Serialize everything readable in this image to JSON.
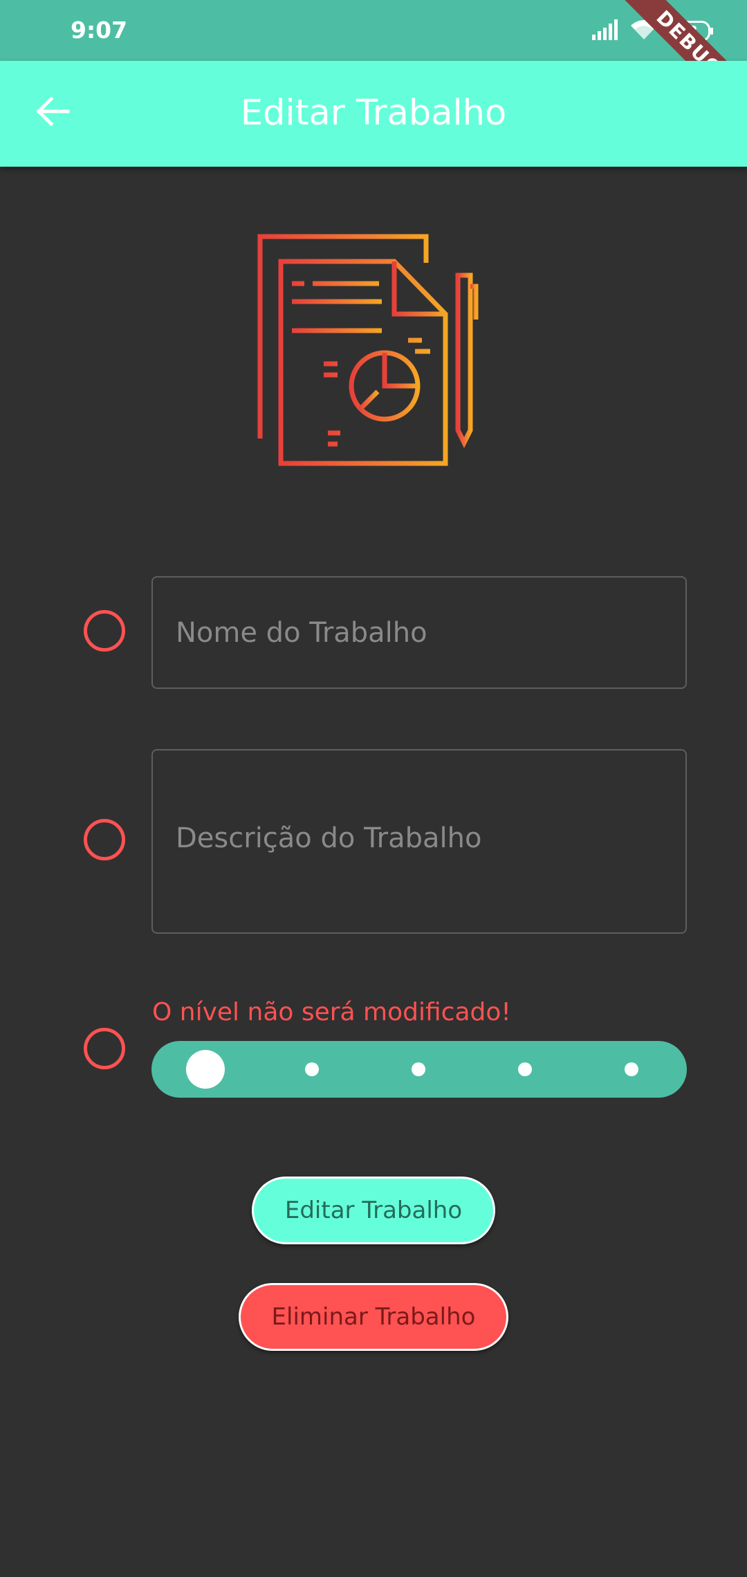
{
  "status_bar": {
    "time": "9:07",
    "battery": "92",
    "icons": [
      "signal-icon",
      "wifi-icon",
      "battery-icon"
    ]
  },
  "debug_banner": "DEBUG",
  "app_bar": {
    "title": "Editar Trabalho",
    "back_icon": "arrow-back-icon"
  },
  "colors": {
    "status_bar": "#4dbea3",
    "app_bar": "#64ffda",
    "background": "#303030",
    "accent_red": "#ff5252",
    "slider": "#4dbea3"
  },
  "form": {
    "name_field": {
      "placeholder": "Nome do Trabalho",
      "value": ""
    },
    "description_field": {
      "placeholder": "Descrição do Trabalho",
      "value": ""
    },
    "level": {
      "warning": "O nível não será modificado!",
      "steps": 5,
      "selected": 1
    }
  },
  "buttons": {
    "edit_label": "Editar Trabalho",
    "delete_label": "Eliminar Trabalho"
  }
}
